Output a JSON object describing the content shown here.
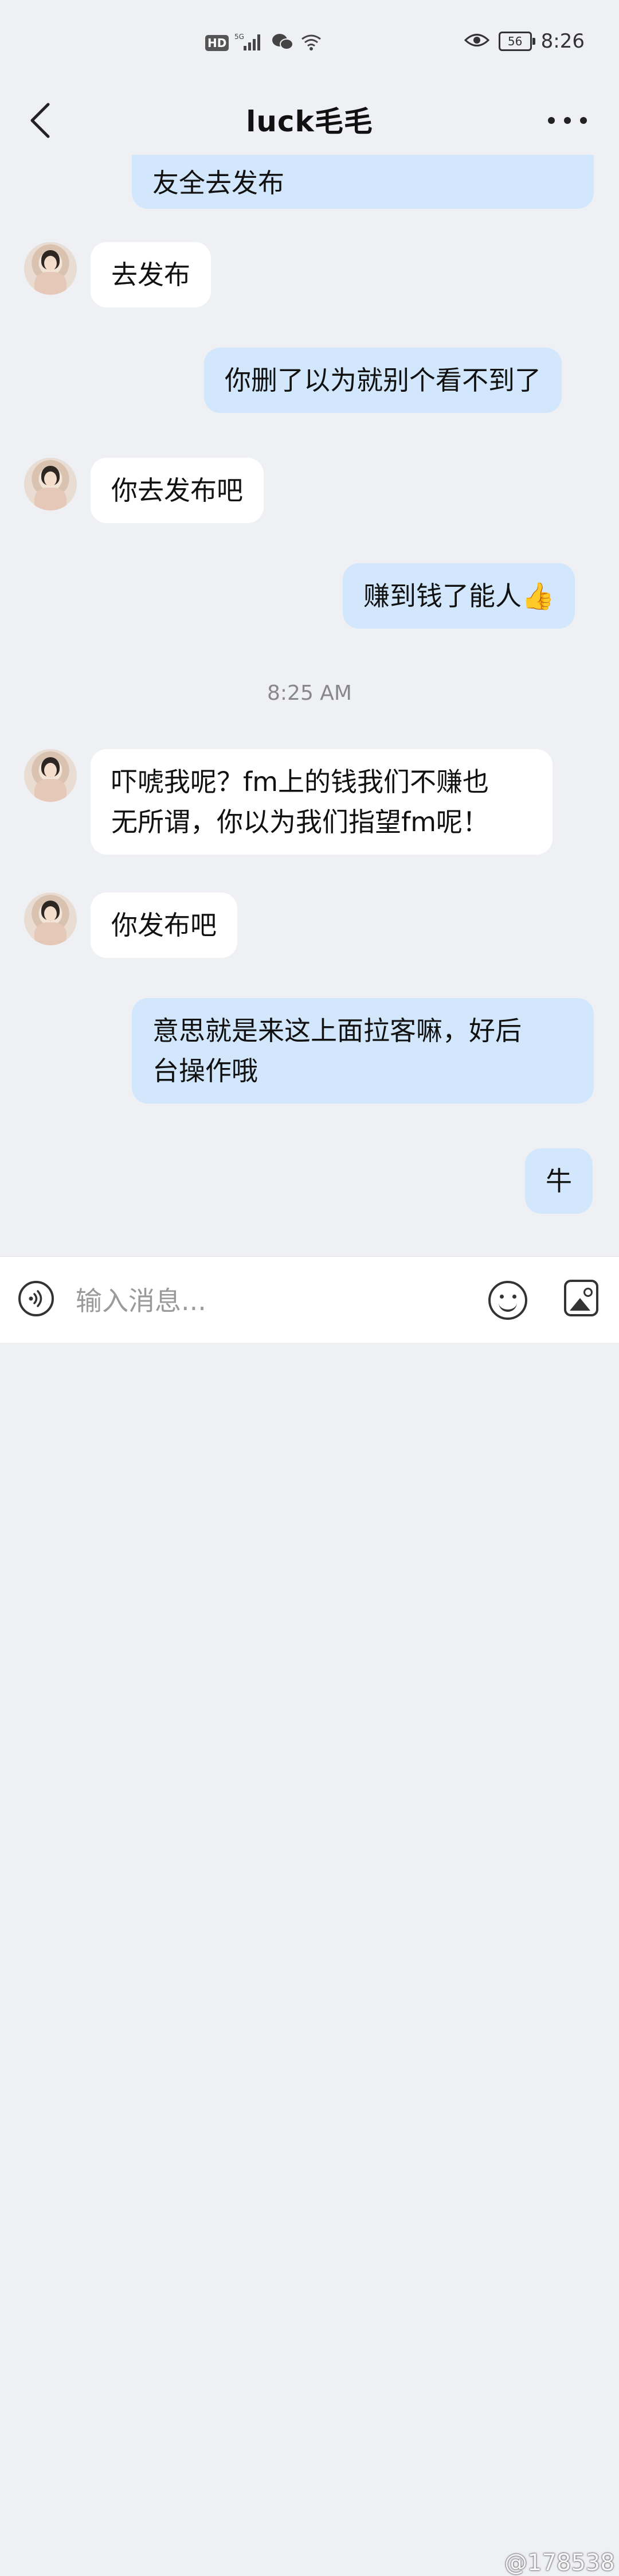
{
  "status_bar": {
    "hd_label": "HD",
    "network_label": "5G",
    "time": "8:26",
    "battery": "56",
    "icons": [
      "hd-icon",
      "signal-icon",
      "wechat-icon",
      "wifi-icon",
      "eye-icon",
      "battery-icon"
    ]
  },
  "header": {
    "title": "luck毛毛",
    "back_icon": "chevron-left-icon",
    "more_icon": "more-dots-icon"
  },
  "messages": [
    {
      "side": "out",
      "text": "友全去发布"
    },
    {
      "side": "in",
      "text": "去发布"
    },
    {
      "side": "out",
      "text": "你删了以为就别个看不到了"
    },
    {
      "side": "in",
      "text": "你去发布吧"
    },
    {
      "side": "out",
      "text": "赚到钱了能人👍"
    },
    {
      "type": "timestamp",
      "text": "8:25 AM"
    },
    {
      "side": "in",
      "text": "吓唬我呢？fm上的钱我们不赚也\n无所谓，你以为我们指望fm呢！"
    },
    {
      "side": "in",
      "text": "你发布吧"
    },
    {
      "side": "out",
      "text": "意思就是来这上面拉客嘛，好后\n台操作哦"
    },
    {
      "side": "out",
      "text": "牛"
    }
  ],
  "input_bar": {
    "placeholder": "输入消息...",
    "voice_icon": "voice-icon",
    "emoji_icon": "emoji-icon",
    "image_icon": "image-icon"
  },
  "watermark": "@178538"
}
